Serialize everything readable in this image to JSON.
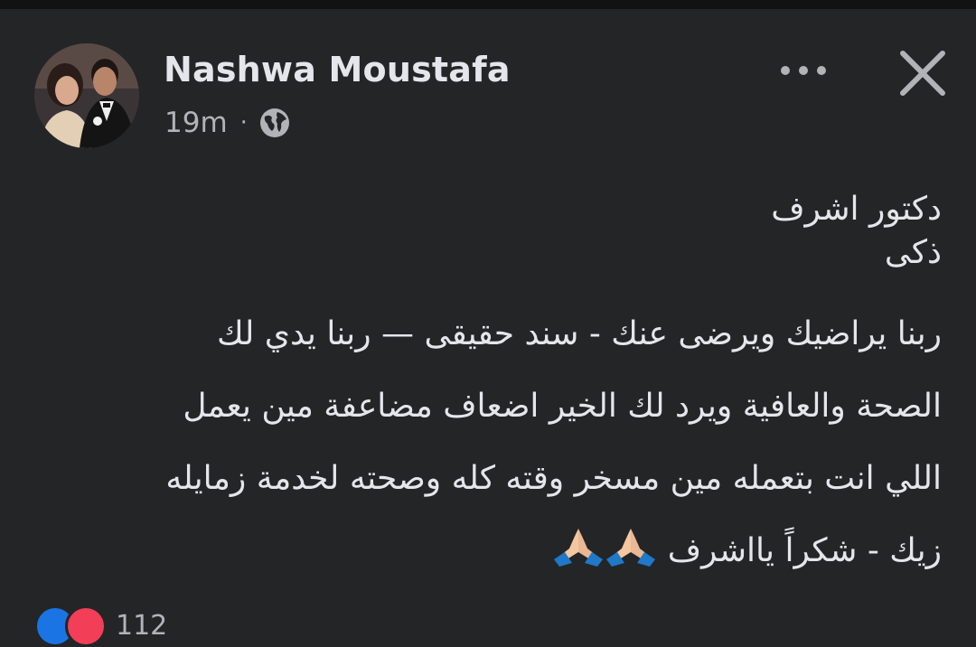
{
  "post": {
    "author_name": "Nashwa Moustafa",
    "timestamp": "19m",
    "separator": "·",
    "privacy_icon": "globe-icon",
    "more_icon": "more-horizontal-icon",
    "close_icon": "close-icon",
    "message": {
      "title_line_1": "دكتور اشرف",
      "title_line_2": "ذكى",
      "line_1": "ربنا يراضيك ويرضى عنك -  سند حقيقى —  ربنا يدي لك",
      "line_2": "الصحة والعافية ويرد لك الخير اضعاف مضاعفة مين يعمل",
      "line_3": "اللي انت بتعمله مين مسخر وقته كله وصحته لخدمة زمايله",
      "line_4": "زيك - شكراً يااشرف"
    },
    "emoji": [
      "folded-hands-emoji",
      "folded-hands-emoji"
    ],
    "reactions": {
      "icons": [
        "like-reaction-icon",
        "love-reaction-icon"
      ],
      "count": "112"
    }
  },
  "colors": {
    "background": "#242526",
    "text_primary": "#e4e6eb",
    "text_secondary": "#b0b3b8"
  }
}
